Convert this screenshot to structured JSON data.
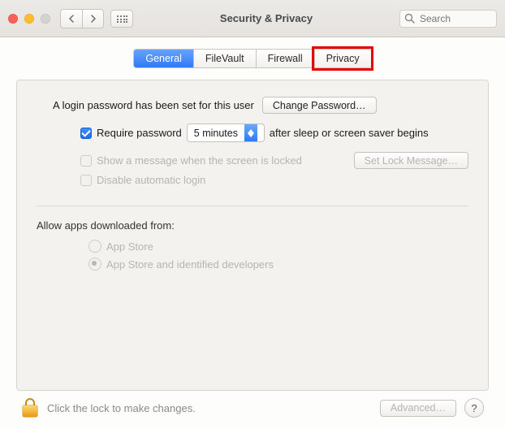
{
  "window": {
    "title": "Security & Privacy"
  },
  "search": {
    "placeholder": "Search"
  },
  "tabs": {
    "items": [
      {
        "label": "General"
      },
      {
        "label": "FileVault"
      },
      {
        "label": "Firewall"
      },
      {
        "label": "Privacy"
      }
    ],
    "active_index": 0,
    "highlighted_index": 3
  },
  "general": {
    "login_password_set_text": "A login password has been set for this user",
    "change_password_label": "Change Password…",
    "require_password": {
      "checked": true,
      "prefix_label": "Require password",
      "delay_value": "5 minutes",
      "suffix_label": "after sleep or screen saver begins"
    },
    "show_message": {
      "checked": false,
      "label": "Show a message when the screen is locked",
      "button_label": "Set Lock Message…"
    },
    "disable_auto_login": {
      "checked": false,
      "label": "Disable automatic login"
    },
    "downloads": {
      "section_label": "Allow apps downloaded from:",
      "options": [
        {
          "label": "App Store",
          "selected": false
        },
        {
          "label": "App Store and identified developers",
          "selected": true
        }
      ]
    }
  },
  "footer": {
    "lock_text": "Click the lock to make changes.",
    "advanced_label": "Advanced…",
    "help_label": "?"
  }
}
